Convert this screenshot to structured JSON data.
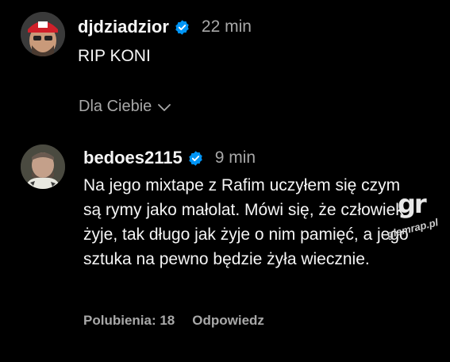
{
  "post": {
    "username": "djdziadzior",
    "time": "22 min",
    "text": "RIP KONI",
    "verified_icon": "verified-badge-icon"
  },
  "filter": {
    "label": "Dla Ciebie",
    "icon": "chevron-down-icon"
  },
  "reply": {
    "username": "bedoes2115",
    "time": "9 min",
    "text": "Na jego mixtape z Rafim uczyłem się czym są rymy jako małolat. Mówi się, że człowiek żyje, tak długo jak żyje o nim pamięć, a jego sztuka na pewno będzie żyła wiecznie.",
    "likes_label": "Polubienia: 18",
    "reply_label": "Odpowiedz"
  },
  "watermark": {
    "logo": "gr",
    "text": "glamrap.pl"
  },
  "colors": {
    "background": "#000000",
    "text_primary": "#f5f5f5",
    "text_secondary": "#a8a8a8",
    "verified_blue": "#0095f6"
  }
}
